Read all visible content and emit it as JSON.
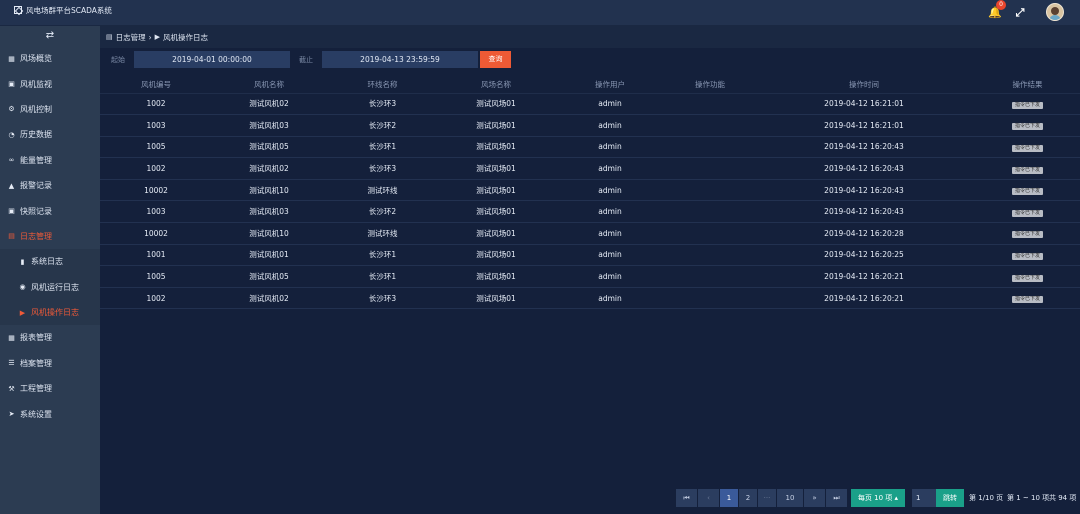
{
  "app": {
    "title": "风电场群平台SCADA系统"
  },
  "topbar": {
    "notification_count": "0"
  },
  "sidebar": {
    "toggle_icon": "collapse-icon",
    "items": [
      {
        "label": "风场概览",
        "icon": "grid-icon"
      },
      {
        "label": "风机监视",
        "icon": "camera-icon"
      },
      {
        "label": "风机控制",
        "icon": "gear-icon"
      },
      {
        "label": "历史数据",
        "icon": "pie-icon"
      },
      {
        "label": "能量管理",
        "icon": "link-icon"
      },
      {
        "label": "报警记录",
        "icon": "bell-icon"
      },
      {
        "label": "快照记录",
        "icon": "camera-icon"
      },
      {
        "label": "日志管理",
        "icon": "file-icon",
        "active": true
      },
      {
        "label": "系统日志",
        "icon": "book-icon"
      },
      {
        "label": "风机运行日志",
        "icon": "car-icon"
      },
      {
        "label": "风机操作日志",
        "icon": "play-icon",
        "active": true
      },
      {
        "label": "报表管理",
        "icon": "table-icon"
      },
      {
        "label": "档案管理",
        "icon": "list-icon"
      },
      {
        "label": "工程管理",
        "icon": "wrench-icon"
      },
      {
        "label": "系统设置",
        "icon": "send-icon"
      }
    ]
  },
  "breadcrumb": {
    "parent": "日志管理",
    "separator": "›",
    "current": "风机操作日志"
  },
  "filter": {
    "start_label": "起始",
    "start_value": "2019-04-01 00:00:00",
    "end_label": "截止",
    "end_value": "2019-04-13 23:59:59",
    "query_button": "查询"
  },
  "table": {
    "headers": [
      "风机编号",
      "风机名称",
      "环线名称",
      "风场名称",
      "操作用户",
      "操作功能",
      "操作时间",
      "操作结果"
    ],
    "rows": [
      [
        "1002",
        "测试风机02",
        "长沙环3",
        "测试风场01",
        "admin",
        "",
        "2019-04-12 16:21:01",
        "指令已下发"
      ],
      [
        "1003",
        "测试风机03",
        "长沙环2",
        "测试风场01",
        "admin",
        "",
        "2019-04-12 16:21:01",
        "指令已下发"
      ],
      [
        "1005",
        "测试风机05",
        "长沙环1",
        "测试风场01",
        "admin",
        "",
        "2019-04-12 16:20:43",
        "指令已下发"
      ],
      [
        "1002",
        "测试风机02",
        "长沙环3",
        "测试风场01",
        "admin",
        "",
        "2019-04-12 16:20:43",
        "指令已下发"
      ],
      [
        "10002",
        "测试风机10",
        "测试环线",
        "测试风场01",
        "admin",
        "",
        "2019-04-12 16:20:43",
        "指令已下发"
      ],
      [
        "1003",
        "测试风机03",
        "长沙环2",
        "测试风场01",
        "admin",
        "",
        "2019-04-12 16:20:43",
        "指令已下发"
      ],
      [
        "10002",
        "测试风机10",
        "测试环线",
        "测试风场01",
        "admin",
        "",
        "2019-04-12 16:20:28",
        "指令已下发"
      ],
      [
        "1001",
        "测试风机01",
        "长沙环1",
        "测试风场01",
        "admin",
        "",
        "2019-04-12 16:20:25",
        "指令已下发"
      ],
      [
        "1005",
        "测试风机05",
        "长沙环1",
        "测试风场01",
        "admin",
        "",
        "2019-04-12 16:20:21",
        "指令已下发"
      ],
      [
        "1002",
        "测试风机02",
        "长沙环3",
        "测试风场01",
        "admin",
        "",
        "2019-04-12 16:20:21",
        "指令已下发"
      ]
    ]
  },
  "pagination": {
    "first": "⏮",
    "prev": "‹",
    "pages": [
      "1",
      "2",
      "···",
      "10"
    ],
    "next": "»",
    "last": "⏭",
    "page_size": "每页 10 项 ▴",
    "jump_value": "1",
    "jump_button": "跳转",
    "page_info": "第 1/10 页",
    "range_info": "第 1 ~ 10 项",
    "total_info": "共 94 项"
  }
}
